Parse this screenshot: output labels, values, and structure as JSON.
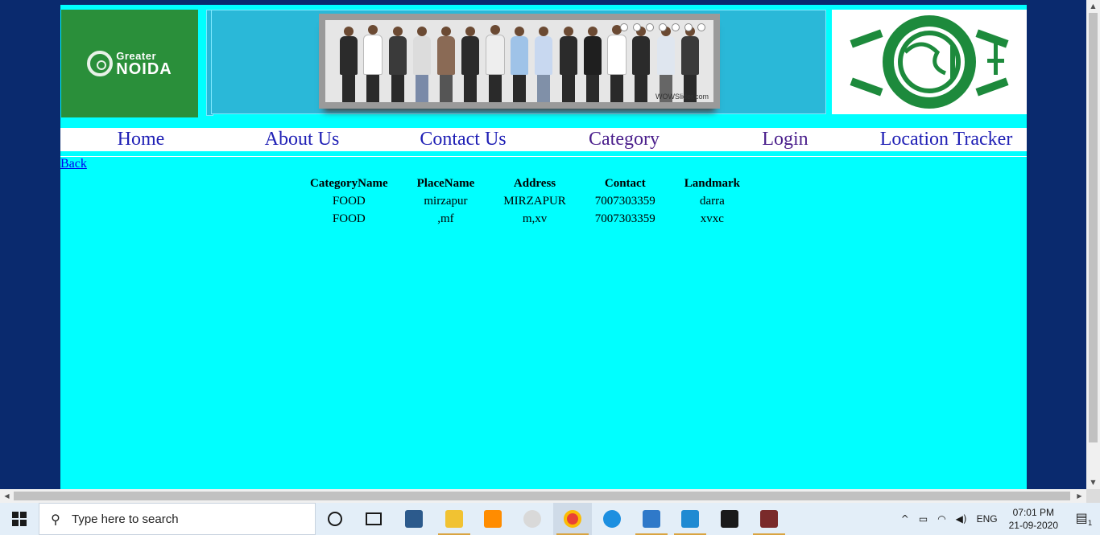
{
  "header": {
    "logo_left_line1": "Greater",
    "logo_left_line2": "NOIDA",
    "slider_credit": "WOWSlider.com"
  },
  "nav": {
    "items": [
      "Home",
      "About Us",
      "Contact Us",
      "Category",
      "Login",
      "Location Tracker"
    ]
  },
  "back_link": "Back",
  "table": {
    "headers": [
      "CategoryName",
      "PlaceName",
      "Address",
      "Contact",
      "Landmark"
    ],
    "rows": [
      [
        "FOOD",
        "mirzapur",
        "MIRZAPUR",
        "7007303359",
        "darra"
      ],
      [
        "FOOD",
        ",mf",
        "m,xv",
        "7007303359",
        "xvxc"
      ]
    ]
  },
  "taskbar": {
    "search_placeholder": "Type here to search",
    "language": "ENG",
    "time": "07:01 PM",
    "date": "21-09-2020",
    "notification_count": "1"
  }
}
